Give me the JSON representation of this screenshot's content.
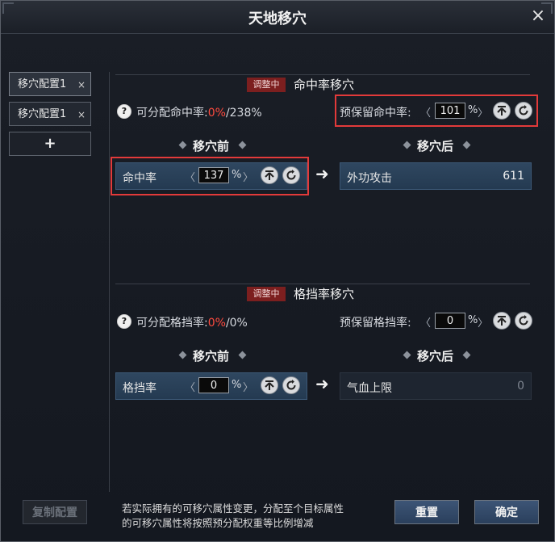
{
  "window": {
    "title": "天地移穴",
    "close_label": "×"
  },
  "sidebar": {
    "tabs": [
      {
        "label": "移穴配置1",
        "close": "×"
      },
      {
        "label": "移穴配置1",
        "close": "×"
      }
    ],
    "add_label": "+"
  },
  "sections": [
    {
      "badge": "调整中",
      "title": "命中率移穴",
      "alloc_label": "可分配命中率:",
      "alloc_pct": "0%",
      "alloc_total": "/238%",
      "reserve_label": "预保留命中率:",
      "reserve_value": "101",
      "before_label": "移穴前",
      "after_label": "移穴后",
      "source_attr": "命中率",
      "source_value": "137",
      "target_attr": "外功攻击",
      "target_value": "611"
    },
    {
      "badge": "调整中",
      "title": "格挡率移穴",
      "alloc_label": "可分配格挡率:",
      "alloc_pct": "0%",
      "alloc_total": "/0%",
      "reserve_label": "预保留格挡率:",
      "reserve_value": "0",
      "before_label": "移穴前",
      "after_label": "移穴后",
      "source_attr": "格挡率",
      "source_value": "0",
      "target_attr": "气血上限",
      "target_value": "0"
    }
  ],
  "common": {
    "percent": "%",
    "help": "?",
    "chev_left": "〈",
    "chev_right": "〉",
    "arrow": "➜"
  },
  "footer": {
    "copy_label": "复制配置",
    "note_line1": "若实际拥有的可移穴属性变更，分配至个目标属性",
    "note_line2": "的可移穴属性将按照预分配权重等比例增减",
    "reset_label": "重置",
    "confirm_label": "确定"
  }
}
